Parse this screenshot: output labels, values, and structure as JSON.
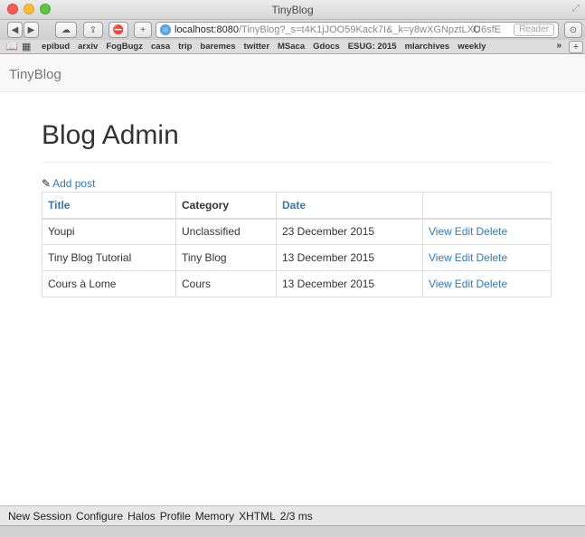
{
  "window": {
    "title": "TinyBlog"
  },
  "toolbar": {
    "url_host": "localhost:8080",
    "url_rest": "/TinyBlog?_s=t4K1jJOO59Kack7I&_k=y8wXGNpztLXU6sfE",
    "reader_label": "Reader",
    "reload_icon": "reload-icon"
  },
  "bookmarks": {
    "items": [
      "epibud",
      "arxiv",
      "FogBugz",
      "casa",
      "trip",
      "baremes",
      "twitter",
      "MSaca",
      "Gdocs",
      "ESUG: 2015",
      "mlarchives",
      "weekly"
    ],
    "more": "»",
    "add": "+"
  },
  "navbar": {
    "brand": "TinyBlog"
  },
  "main": {
    "title": "Blog Admin",
    "add_post": "Add post"
  },
  "table": {
    "headers": [
      "Title",
      "Category",
      "Date",
      ""
    ],
    "rows": [
      {
        "title": "Youpi",
        "category": "Unclassified",
        "date": "23 December 2015",
        "view": "View",
        "edit": "Edit",
        "delete": "Delete"
      },
      {
        "title": "Tiny Blog Tutorial",
        "category": "Tiny Blog",
        "date": "13 December 2015",
        "view": "View",
        "edit": "Edit",
        "delete": "Delete"
      },
      {
        "title": "Cours à Lome",
        "category": "Cours",
        "date": "13 December 2015",
        "view": "View",
        "edit": "Edit",
        "delete": "Delete"
      }
    ]
  },
  "footer": {
    "items": [
      "New Session",
      "Configure",
      "Halos",
      "Profile",
      "Memory",
      "XHTML",
      "2/3 ms"
    ]
  },
  "colors": {
    "link": "#337ab7",
    "navbar": "#f8f8f8",
    "footer": "#e6e6e6"
  }
}
